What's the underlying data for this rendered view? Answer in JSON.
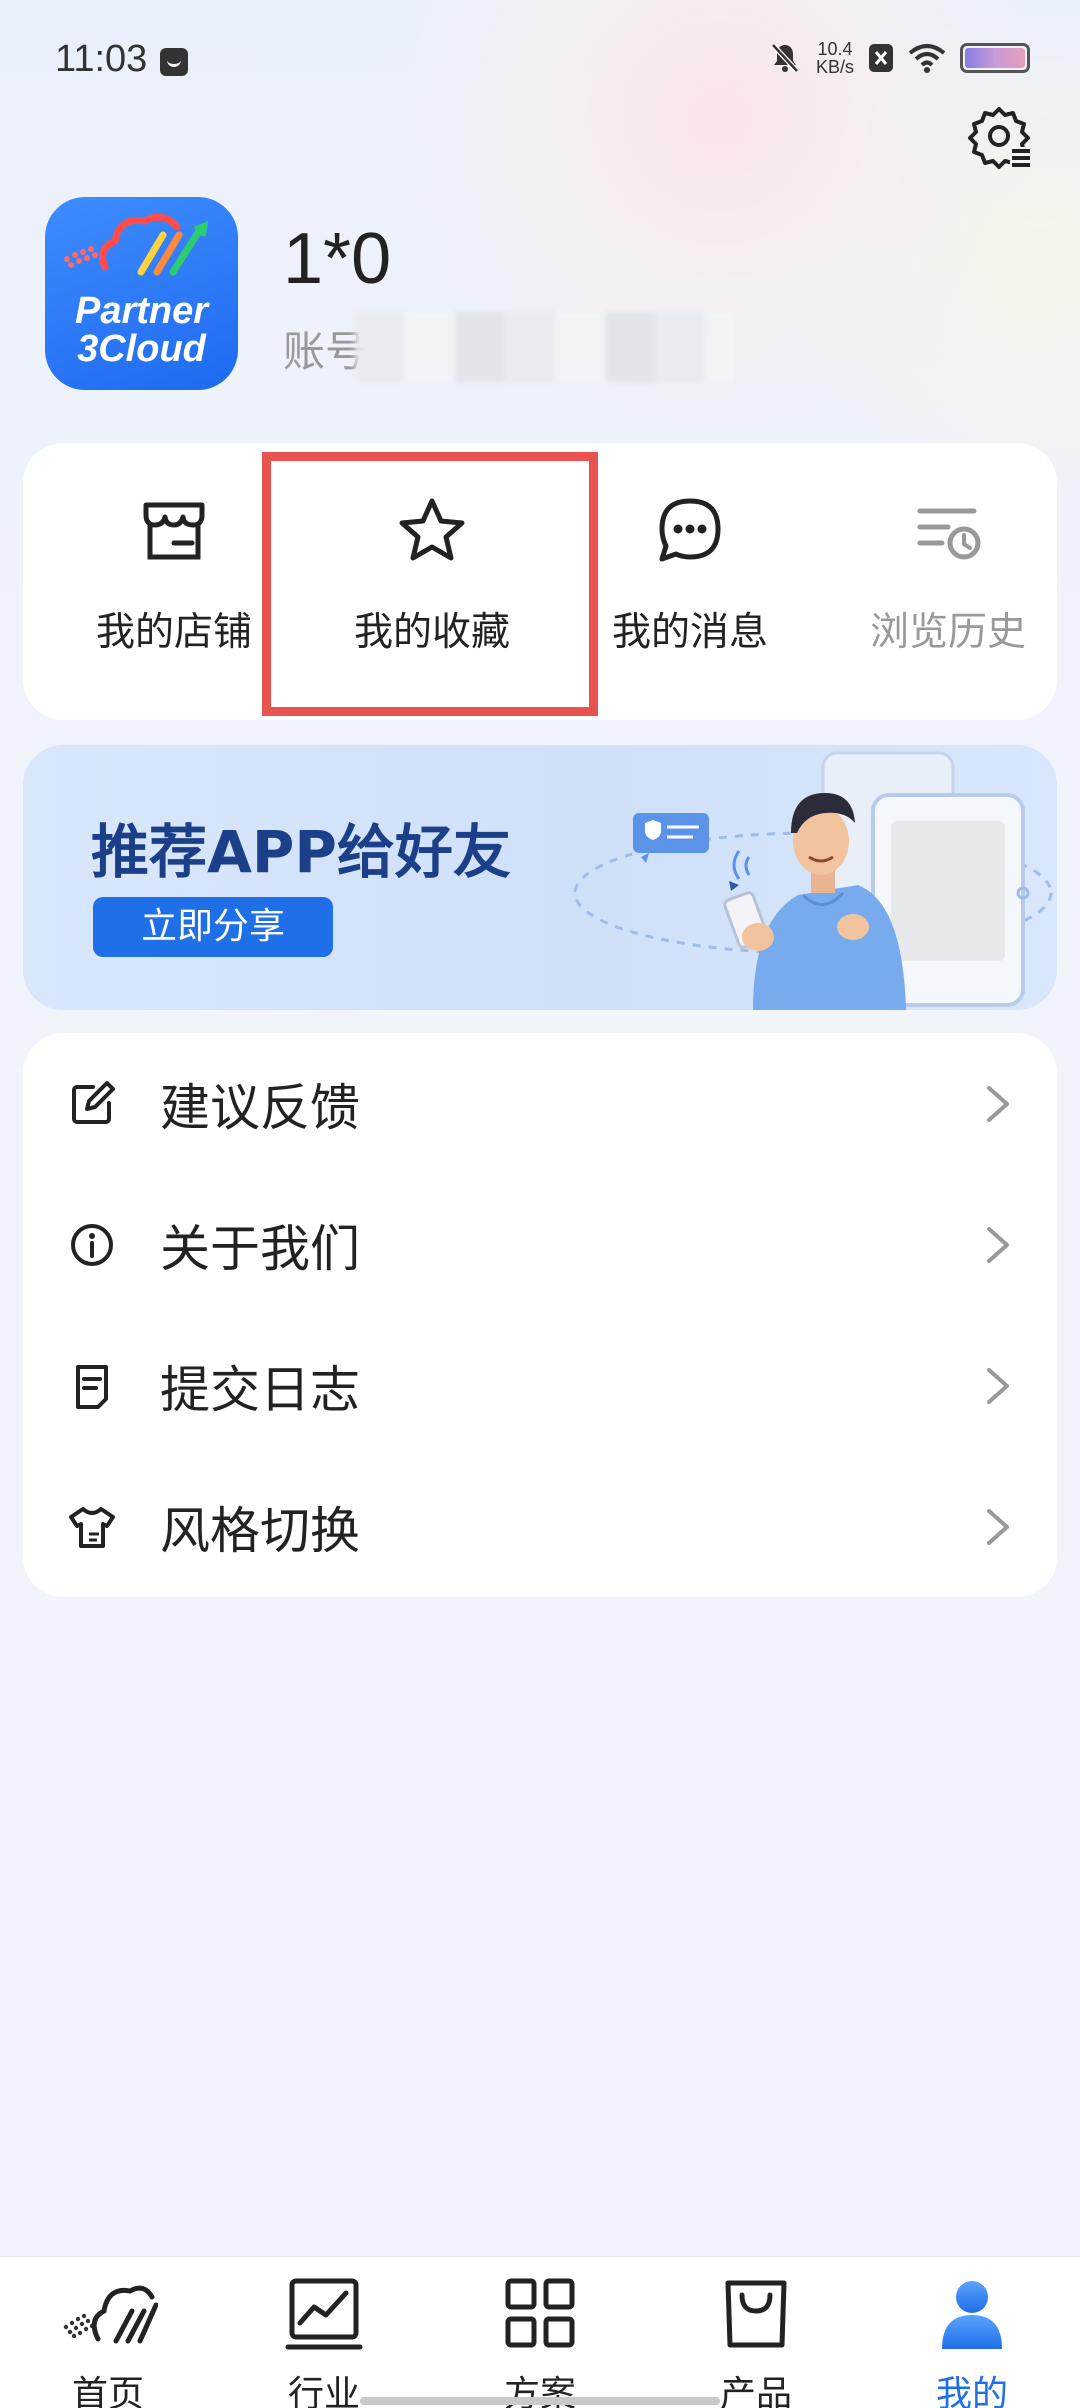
{
  "status_bar": {
    "time": "11:03",
    "net_speed_value": "10.4",
    "net_speed_unit": "KB/s"
  },
  "profile": {
    "app_logo_line1": "Partner",
    "app_logo_line2": "3Cloud",
    "username": "1*0",
    "account_label": "账号"
  },
  "quick_actions": [
    {
      "label": "我的店铺",
      "icon": "store-icon"
    },
    {
      "label": "我的收藏",
      "icon": "star-icon",
      "highlighted": true
    },
    {
      "label": "我的消息",
      "icon": "chat-bubble-icon"
    },
    {
      "label": "浏览历史",
      "icon": "history-icon",
      "dimmed": true
    }
  ],
  "banner": {
    "title": "推荐APP给好友",
    "button_label": "立即分享"
  },
  "menu": [
    {
      "label": "建议反馈",
      "icon": "edit-icon"
    },
    {
      "label": "关于我们",
      "icon": "info-icon"
    },
    {
      "label": "提交日志",
      "icon": "document-icon"
    },
    {
      "label": "风格切换",
      "icon": "shirt-icon"
    }
  ],
  "bottom_nav": [
    {
      "label": "首页",
      "icon": "home-logo-icon"
    },
    {
      "label": "行业",
      "icon": "chart-icon"
    },
    {
      "label": "方案",
      "icon": "grid-icon"
    },
    {
      "label": "产品",
      "icon": "bag-icon"
    },
    {
      "label": "我的",
      "icon": "person-icon",
      "active": true
    }
  ],
  "colors": {
    "accent": "#1e6fe8",
    "highlight_box": "#e8534f",
    "background": "#f2f4fb"
  }
}
